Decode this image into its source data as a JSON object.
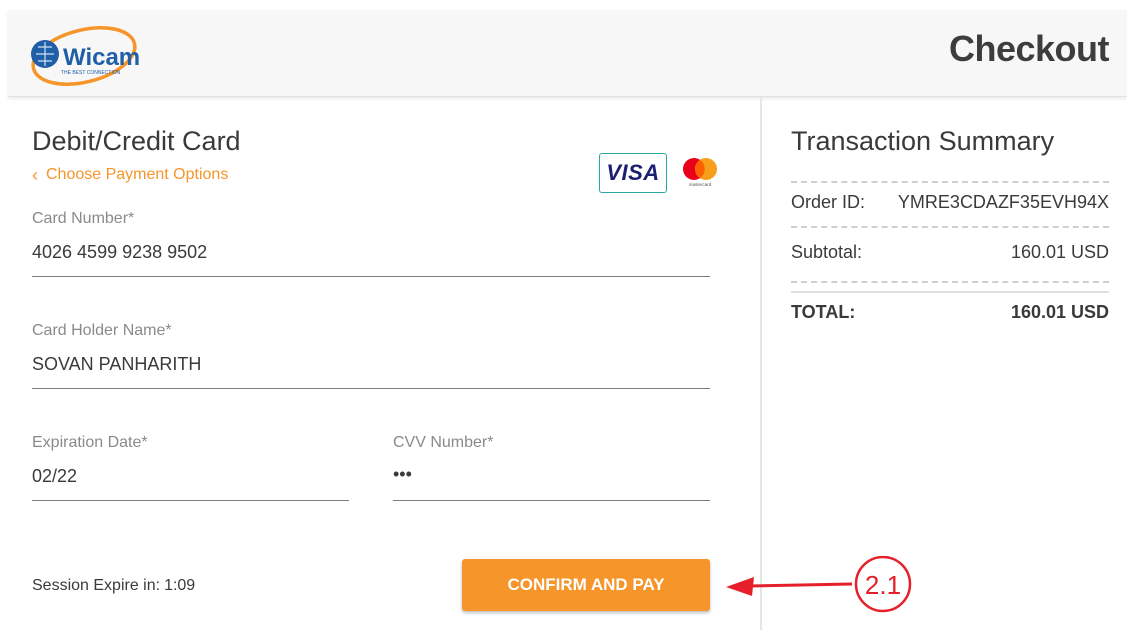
{
  "header": {
    "logo_text": "Wicam",
    "logo_tagline": "THE BEST CONNECTION",
    "title": "Checkout"
  },
  "payment": {
    "title": "Debit/Credit Card",
    "back_link": "Choose Payment Options",
    "card_brands": [
      "VISA",
      "mastercard"
    ],
    "fields": {
      "card_number": {
        "label": "Card Number*",
        "value": "4026 4599 9238 9502"
      },
      "card_holder": {
        "label": "Card Holder Name*",
        "value": "SOVAN PANHARITH"
      },
      "expiration": {
        "label": "Expiration Date*",
        "value": "02/22"
      },
      "cvv": {
        "label": "CVV Number*",
        "value": "•••"
      }
    },
    "session_label": "Session Expire in:",
    "session_time": "1:09",
    "confirm_button": "CONFIRM AND PAY"
  },
  "summary": {
    "title": "Transaction Summary",
    "order_id_label": "Order ID:",
    "order_id": "YMRE3CDAZF35EVH94X",
    "subtotal_label": "Subtotal:",
    "subtotal": "160.01 USD",
    "total_label": "TOTAL:",
    "total": "160.01 USD"
  },
  "annotation": {
    "step": "2.1",
    "color": "#e5202a"
  },
  "colors": {
    "accent": "#f5952a",
    "visa_blue": "#1a1f71",
    "visa_border": "#2aa8a0"
  }
}
